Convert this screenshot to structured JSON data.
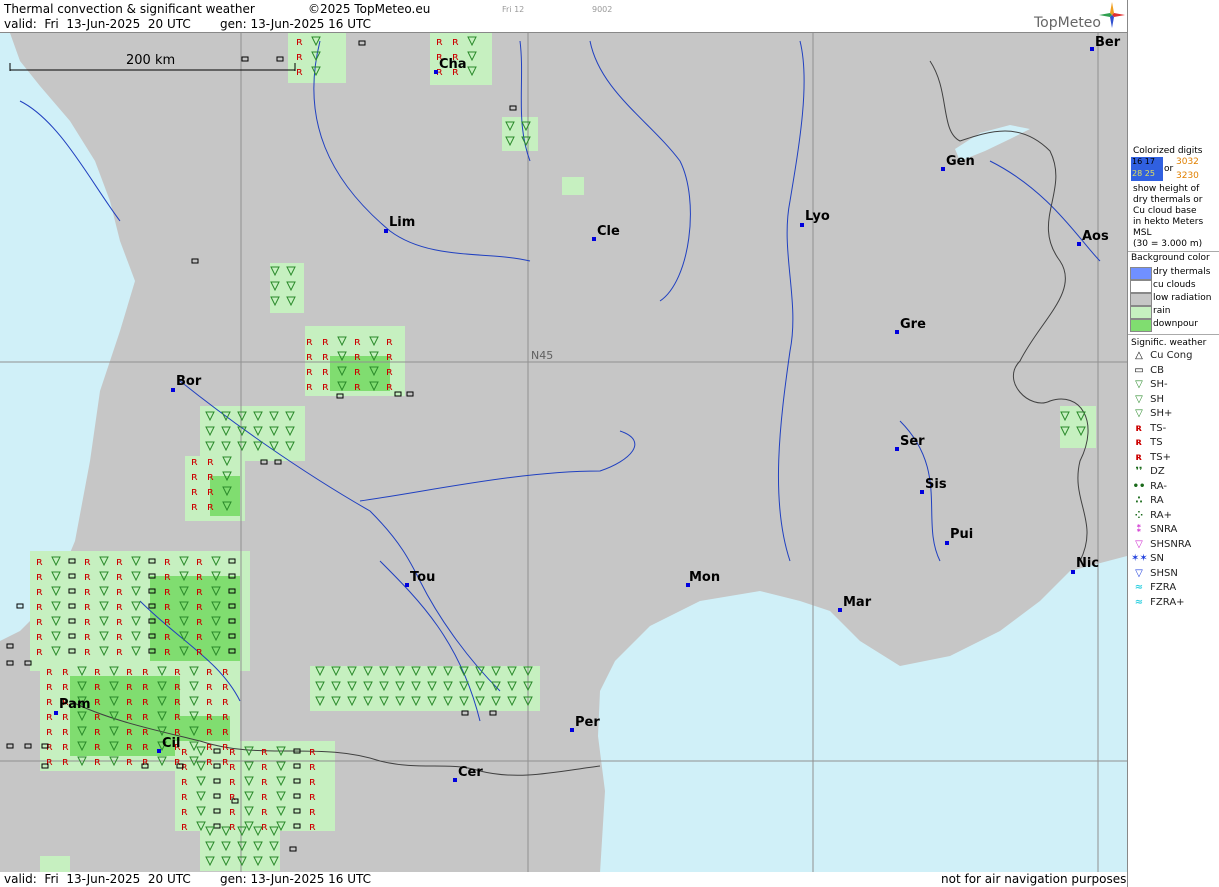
{
  "header": {
    "title": "Thermal convection & significant weather",
    "copyright": "©2025 TopMeteo.eu",
    "day": "Fri 12",
    "code": "9002",
    "valid": "valid:  Fri  13-Jun-2025  20 UTC",
    "gen": "gen: 13-Jun-2025 16 UTC",
    "brand": "TopMeteo"
  },
  "footer": {
    "valid": "valid:  Fri  13-Jun-2025  20 UTC",
    "gen": "gen: 13-Jun-2025 16 UTC",
    "disclaimer": "not for air navigation purposes"
  },
  "map": {
    "scale_label": "200 km",
    "grid_label": "N45",
    "cities": [
      "Cha",
      "Ber",
      "Lim",
      "Cle",
      "Lyo",
      "Gen",
      "Aos",
      "Gre",
      "Bor",
      "Ser",
      "Sis",
      "Pui",
      "Tou",
      "Mon",
      "Nic",
      "Mar",
      "Pam",
      "Cil",
      "Per",
      "Cer"
    ]
  },
  "sidebar": {
    "digits_title": [
      "Colorized digits"
    ],
    "digits_sample_a": "16 17",
    "digits_sample_b": "28 25",
    "digits_or": "or",
    "digits_sample_c": "3032",
    "digits_sample_d": "3230",
    "digits_text": [
      "show height of",
      "dry thermals or",
      "Cu cloud base",
      "in hekto Meters",
      "MSL",
      "(30 = 3.000 m)"
    ],
    "bg_title": "Background color",
    "bg_items": [
      {
        "label": "dry thermals",
        "color": "#7090ff"
      },
      {
        "label": "cu clouds",
        "color": "#ffffff"
      },
      {
        "label": "low radiation",
        "color": "#c6c6c6"
      },
      {
        "label": "rain",
        "color": "#c6f0c0"
      },
      {
        "label": "downpour",
        "color": "#80dd70"
      }
    ],
    "wx_title": "Signific. weather",
    "wx_items": [
      {
        "label": "Cu Cong",
        "icon": "cu-cong-icon",
        "glyph": "△",
        "color": "#000"
      },
      {
        "label": "CB",
        "icon": "cb-icon",
        "glyph": "▭",
        "color": "#000"
      },
      {
        "label": "SH-",
        "icon": "shower-light-icon",
        "glyph": "▽",
        "color": "#2a8a2a"
      },
      {
        "label": "SH",
        "icon": "shower-icon",
        "glyph": "▽",
        "color": "#2a8a2a"
      },
      {
        "label": "SH+",
        "icon": "shower-heavy-icon",
        "glyph": "▽",
        "color": "#2a8a2a"
      },
      {
        "label": "TS-",
        "icon": "thunderstorm-light-icon",
        "glyph": "ʀ",
        "color": "#cc0000"
      },
      {
        "label": "TS",
        "icon": "thunderstorm-icon",
        "glyph": "ʀ",
        "color": "#cc0000"
      },
      {
        "label": "TS+",
        "icon": "thunderstorm-heavy-icon",
        "glyph": "ʀ",
        "color": "#cc0000"
      },
      {
        "label": "DZ",
        "icon": "drizzle-icon",
        "glyph": "❜❜",
        "color": "#1a6a1a"
      },
      {
        "label": "RA-",
        "icon": "rain-light-icon",
        "glyph": "••",
        "color": "#1a6a1a"
      },
      {
        "label": "RA",
        "icon": "rain-icon",
        "glyph": "∴",
        "color": "#1a6a1a"
      },
      {
        "label": "RA+",
        "icon": "rain-heavy-icon",
        "glyph": "⁘",
        "color": "#1a6a1a"
      },
      {
        "label": "SNRA",
        "icon": "snow-rain-icon",
        "glyph": "⁑",
        "color": "#d030d0"
      },
      {
        "label": "SHSNRA",
        "icon": "snow-rain-shower-icon",
        "glyph": "▽",
        "color": "#d030d0"
      },
      {
        "label": "SN",
        "icon": "snow-icon",
        "glyph": "✶✶",
        "color": "#2040dd"
      },
      {
        "label": "SHSN",
        "icon": "snow-shower-icon",
        "glyph": "▽",
        "color": "#2040dd"
      },
      {
        "label": "FZRA",
        "icon": "freezing-rain-icon",
        "glyph": "≈",
        "color": "#30d0e0"
      },
      {
        "label": "FZRA+",
        "icon": "freezing-rain-heavy-icon",
        "glyph": "≈",
        "color": "#30d0e0"
      }
    ]
  }
}
